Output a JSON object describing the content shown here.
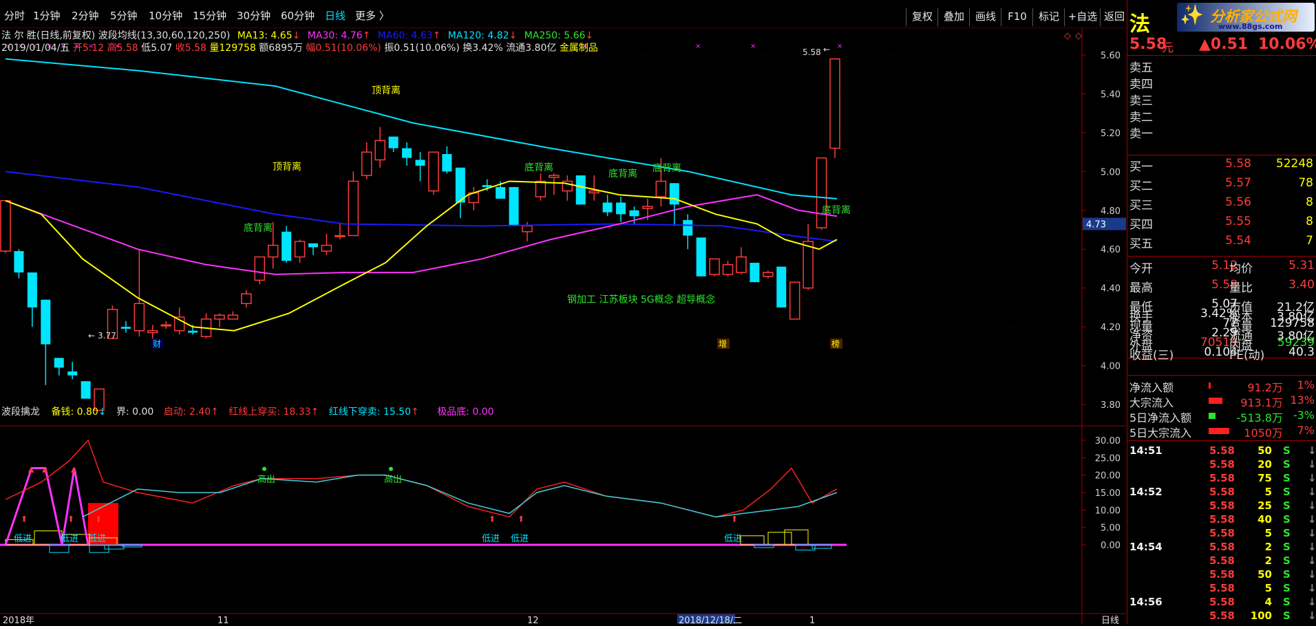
{
  "toolbar": {
    "periods": [
      "分时",
      "1分钟",
      "2分钟",
      "5分钟",
      "10分钟",
      "15分钟",
      "30分钟",
      "60分钟",
      "日线",
      "更多 〉"
    ],
    "active_period": "日线",
    "buttons": [
      "复权",
      "叠加",
      "画线",
      "F10",
      "标记",
      "+自选",
      "返回"
    ]
  },
  "logo": {
    "text": "分析家公式网",
    "url": "www.88gs.com"
  },
  "stock": {
    "name_char": "法",
    "price": "5.58",
    "price_unit": "元",
    "change": "▲0.51",
    "change_pct": "10.06%"
  },
  "info_line1": {
    "title": "法 尔 胜(日线,前复权) 波段均线(13,30,60,120,250)",
    "ma13": "MA13: 4.65",
    "ma30": "MA30: 4.76",
    "ma60": "MA60: 4.63",
    "ma120": "MA120: 4.82",
    "ma250": "MA250: 5.66"
  },
  "info_line2": {
    "date": "2019/01/04/五",
    "open": "开5.12",
    "high": "高5.58",
    "low": "低5.07",
    "close": "收5.58",
    "vol": "量129758",
    "amount": "额6895万",
    "rise": "幅0.51(10.06%)",
    "amp": "振0.51(10.06%)",
    "turnover": "换3.42%",
    "float": "流通3.80亿",
    "sector": "金属制品"
  },
  "price_axis": [
    "5.60",
    "5.40",
    "5.20",
    "5.00",
    "4.80",
    "4.60",
    "4.40",
    "4.20",
    "4.00",
    "3.80"
  ],
  "current_price_tag": "4.73",
  "annotations": {
    "top_div_1": "顶背离",
    "top_div_2": "顶背离",
    "bot_div_1": "底背离",
    "bot_div_2": "底背离",
    "bot_div_3": "底背离",
    "bot_div_4": "底背离",
    "bot_div_5": "底背离",
    "high_label": "5.58",
    "low_label": "3.77",
    "concepts": "钢加工    江苏板块    5G概念  超导概念",
    "marker_cai": "财",
    "marker_zeng": "增",
    "marker_bang": "榜"
  },
  "indicator": {
    "title": "波段擒龙",
    "bei_qian": "备钱: 0.80",
    "jie": "界: 0.00",
    "qi_dong": "启动: 2.40",
    "red_up": "红线上穿买: 18.33",
    "red_down": "红线下穿卖: 15.50",
    "ji_pin": "极品底: 0.00",
    "axis": [
      "30.00",
      "25.00",
      "20.00",
      "15.00",
      "10.00",
      "5.00",
      "0.00"
    ],
    "gao_chu": "高出",
    "di_jin": "低进"
  },
  "date_axis": {
    "d1": "2018年",
    "d2": "11",
    "d3": "12",
    "d4": "2018/12/18/二",
    "d5": "1",
    "mode": "日线"
  },
  "order_book": {
    "sells": [
      {
        "label": "卖五",
        "price": "",
        "vol": ""
      },
      {
        "label": "卖四",
        "price": "",
        "vol": ""
      },
      {
        "label": "卖三",
        "price": "",
        "vol": ""
      },
      {
        "label": "卖二",
        "price": "",
        "vol": ""
      },
      {
        "label": "卖一",
        "price": "",
        "vol": ""
      }
    ],
    "buys": [
      {
        "label": "买一",
        "price": "5.58",
        "vol": "52248"
      },
      {
        "label": "买二",
        "price": "5.57",
        "vol": "78"
      },
      {
        "label": "买三",
        "price": "5.56",
        "vol": "8"
      },
      {
        "label": "买四",
        "price": "5.55",
        "vol": "8"
      },
      {
        "label": "买五",
        "price": "5.54",
        "vol": "7"
      }
    ]
  },
  "stats": [
    {
      "l1": "今开",
      "v1": "5.12",
      "l2": "均价",
      "v2": "5.31"
    },
    {
      "l1": "最高",
      "v1": "5.58",
      "l2": "量比",
      "v2": "3.40"
    },
    {
      "l1": "最低",
      "v1": "5.07",
      "l2": "市值",
      "v2": "21.2亿"
    },
    {
      "l1": "现量",
      "v1": "77",
      "l2": "总量",
      "v2": "129758"
    },
    {
      "l1": "外盘",
      "v1": "70519",
      "l2": "内盘",
      "v2": "59239"
    }
  ],
  "stats2": [
    {
      "l1": "换手",
      "v1": "3.42%",
      "l2": "股本",
      "v2": "3.80亿"
    },
    {
      "l1": "净资",
      "v1": "2.29",
      "l2": "流通",
      "v2": "3.80亿"
    },
    {
      "l1": "收益(三)",
      "v1": "0.104",
      "l2": "PE(动)",
      "v2": "40.3"
    }
  ],
  "flows": [
    {
      "label": "净流入额",
      "value": "91.2万",
      "pct": "1%"
    },
    {
      "label": "大宗流入",
      "value": "913.1万",
      "pct": "13%"
    },
    {
      "label": "5日净流入额",
      "value": "-513.8万",
      "pct": "-3%"
    },
    {
      "label": "5日大宗流入",
      "value": "1050万",
      "pct": "7%"
    }
  ],
  "ticks": [
    {
      "time": "14:51",
      "price": "5.58",
      "vol": "50",
      "side": "S"
    },
    {
      "time": "",
      "price": "5.58",
      "vol": "20",
      "side": "S"
    },
    {
      "time": "",
      "price": "5.58",
      "vol": "75",
      "side": "S"
    },
    {
      "time": "14:52",
      "price": "5.58",
      "vol": "5",
      "side": "S"
    },
    {
      "time": "",
      "price": "5.58",
      "vol": "25",
      "side": "S"
    },
    {
      "time": "",
      "price": "5.58",
      "vol": "40",
      "side": "S"
    },
    {
      "time": "",
      "price": "5.58",
      "vol": "5",
      "side": "S"
    },
    {
      "time": "14:54",
      "price": "5.58",
      "vol": "2",
      "side": "S"
    },
    {
      "time": "",
      "price": "5.58",
      "vol": "2",
      "side": "S"
    },
    {
      "time": "",
      "price": "5.58",
      "vol": "50",
      "side": "S"
    },
    {
      "time": "",
      "price": "5.58",
      "vol": "5",
      "side": "S"
    },
    {
      "time": "14:56",
      "price": "5.58",
      "vol": "4",
      "side": "S"
    },
    {
      "time": "",
      "price": "5.58",
      "vol": "100",
      "side": "S"
    }
  ],
  "candles": [
    [
      4.59,
      4.85,
      4.58,
      4.85
    ],
    [
      4.59,
      4.6,
      4.45,
      4.48
    ],
    [
      4.48,
      4.48,
      4.2,
      4.3
    ],
    [
      4.34,
      4.34,
      3.9,
      4.11
    ],
    [
      4.04,
      4.04,
      3.95,
      3.99
    ],
    [
      3.97,
      4.02,
      3.93,
      3.95
    ],
    [
      3.92,
      3.92,
      3.83,
      3.83
    ],
    [
      3.77,
      3.88,
      3.77,
      3.88
    ],
    [
      4.14,
      4.31,
      4.14,
      4.29
    ],
    [
      4.2,
      4.23,
      4.17,
      4.19
    ],
    [
      4.18,
      4.6,
      4.15,
      4.32
    ],
    [
      4.17,
      4.21,
      4.12,
      4.18
    ],
    [
      4.21,
      4.23,
      4.19,
      4.21
    ],
    [
      4.18,
      4.3,
      4.16,
      4.25
    ],
    [
      4.18,
      4.21,
      4.16,
      4.17
    ],
    [
      4.15,
      4.27,
      4.14,
      4.24
    ],
    [
      4.24,
      4.27,
      4.2,
      4.26
    ],
    [
      4.24,
      4.28,
      4.24,
      4.26
    ],
    [
      4.32,
      4.39,
      4.3,
      4.37
    ],
    [
      4.44,
      4.56,
      4.42,
      4.56
    ],
    [
      4.56,
      4.74,
      4.5,
      4.62
    ],
    [
      4.69,
      4.72,
      4.53,
      4.54
    ],
    [
      4.56,
      4.65,
      4.53,
      4.64
    ],
    [
      4.63,
      4.63,
      4.57,
      4.61
    ],
    [
      4.59,
      4.68,
      4.57,
      4.62
    ],
    [
      4.67,
      4.73,
      4.65,
      4.67
    ],
    [
      4.67,
      5.0,
      4.67,
      4.95
    ],
    [
      4.98,
      5.15,
      4.96,
      5.1
    ],
    [
      5.06,
      5.23,
      5.02,
      5.16
    ],
    [
      5.18,
      5.18,
      5.1,
      5.12
    ],
    [
      5.12,
      5.15,
      5.03,
      5.07
    ],
    [
      5.06,
      5.1,
      4.95,
      5.03
    ],
    [
      4.9,
      5.1,
      4.88,
      5.1
    ],
    [
      5.09,
      5.13,
      4.99,
      5.0
    ],
    [
      5.02,
      5.02,
      4.76,
      4.84
    ],
    [
      4.84,
      4.92,
      4.8,
      4.89
    ],
    [
      4.93,
      4.96,
      4.9,
      4.92
    ],
    [
      4.92,
      4.95,
      4.86,
      4.86
    ],
    [
      4.92,
      4.92,
      4.72,
      4.72
    ],
    [
      4.69,
      4.74,
      4.64,
      4.72
    ],
    [
      4.87,
      4.99,
      4.85,
      4.95
    ],
    [
      4.97,
      4.99,
      4.88,
      4.98
    ],
    [
      4.9,
      4.98,
      4.85,
      4.95
    ],
    [
      4.98,
      4.98,
      4.83,
      4.83
    ],
    [
      4.89,
      4.98,
      4.85,
      4.9
    ],
    [
      4.84,
      4.88,
      4.77,
      4.79
    ],
    [
      4.84,
      4.87,
      4.74,
      4.78
    ],
    [
      4.8,
      4.82,
      4.73,
      4.77
    ],
    [
      4.81,
      4.86,
      4.75,
      4.82
    ],
    [
      4.87,
      5.07,
      4.82,
      4.95
    ],
    [
      4.94,
      4.94,
      4.72,
      4.83
    ],
    [
      4.75,
      4.78,
      4.6,
      4.67
    ],
    [
      4.66,
      4.66,
      4.46,
      4.46
    ],
    [
      4.47,
      4.55,
      4.46,
      4.55
    ],
    [
      4.47,
      4.54,
      4.46,
      4.52
    ],
    [
      4.48,
      4.61,
      4.47,
      4.56
    ],
    [
      4.53,
      4.53,
      4.43,
      4.43
    ],
    [
      4.46,
      4.49,
      4.45,
      4.48
    ],
    [
      4.51,
      4.51,
      4.3,
      4.3
    ],
    [
      4.24,
      4.4,
      4.24,
      4.43
    ],
    [
      4.4,
      4.73,
      4.39,
      4.64
    ],
    [
      4.71,
      5.07,
      4.7,
      5.07
    ],
    [
      5.12,
      5.58,
      5.07,
      5.58
    ]
  ]
}
